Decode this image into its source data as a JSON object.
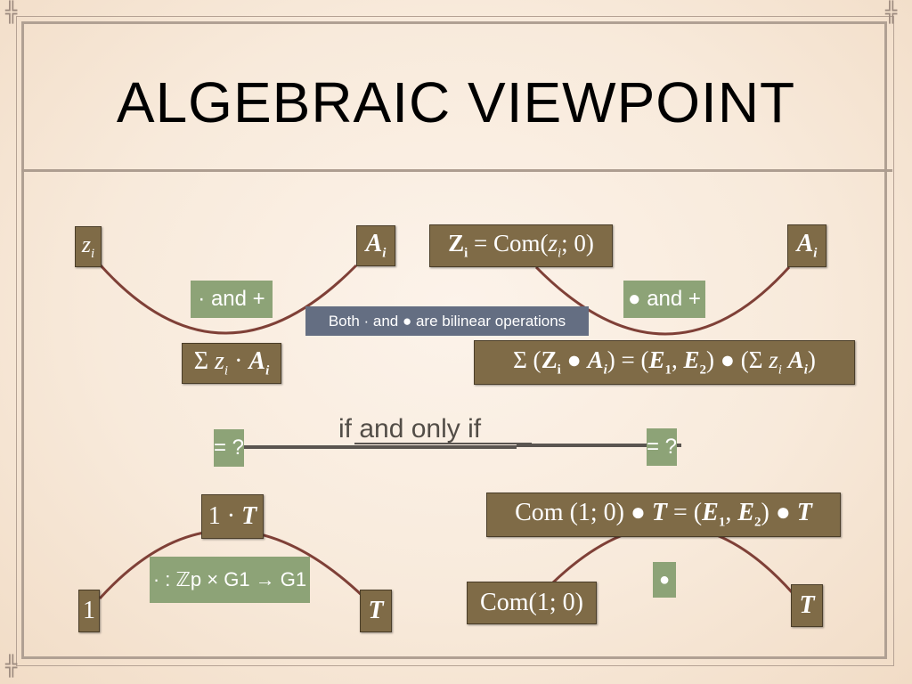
{
  "title": "ALGEBRAIC VIEWPOINT",
  "top_left": {
    "left_node": "z_i",
    "right_node": "A_i",
    "operation_label": "· and +",
    "result_node": "Σ z_i · A_i"
  },
  "top_right": {
    "left_node": "Z_i = Com(z_i; 0)",
    "right_node": "A_i",
    "operation_label": "● and +",
    "result_node": "Σ (Z_i ● A_i) = (E_1, E_2) ● (Σ z_i A_i)"
  },
  "note": "Both · and ● are bilinear operations",
  "equivalence": {
    "left_label": "= ?",
    "right_label": "= ?",
    "connector_text": "if and only if"
  },
  "bottom_left": {
    "top_node": "1 · T",
    "left_node": "1",
    "right_node": "T",
    "operation_label": "· : ℤp × G1 → G1"
  },
  "bottom_right": {
    "top_node": "Com (1; 0) ● T = (E_1, E_2) ● T",
    "left_node": "Com(1; 0)",
    "right_node": "T",
    "operation_label": "●"
  },
  "colors": {
    "node_fill": "#7f6b47",
    "label_fill": "#8da377",
    "note_fill": "#646e82",
    "curve": "#7f4037",
    "connector": "#5a5550"
  }
}
